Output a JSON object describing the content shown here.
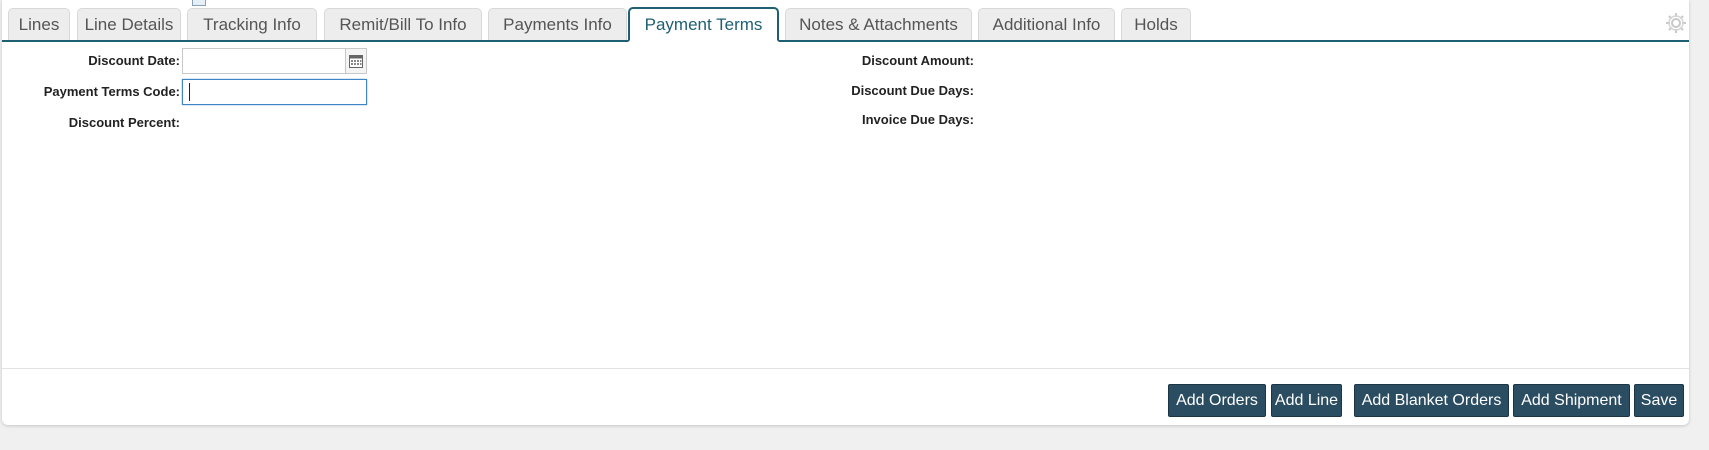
{
  "tabs": [
    {
      "label": "Lines"
    },
    {
      "label": "Line Details"
    },
    {
      "label": "Tracking Info"
    },
    {
      "label": "Remit/Bill To Info"
    },
    {
      "label": "Payments Info"
    },
    {
      "label": "Payment Terms",
      "active": true
    },
    {
      "label": "Notes & Attachments"
    },
    {
      "label": "Additional Info"
    },
    {
      "label": "Holds"
    }
  ],
  "form": {
    "left": {
      "discount_date_label": "Discount Date:",
      "discount_date_value": "",
      "payment_terms_code_label": "Payment Terms Code:",
      "payment_terms_code_value": "",
      "discount_percent_label": "Discount Percent:"
    },
    "right": {
      "discount_amount_label": "Discount Amount:",
      "discount_due_days_label": "Discount Due Days:",
      "invoice_due_days_label": "Invoice Due Days:"
    }
  },
  "footer": {
    "add_orders": "Add Orders",
    "add_line": "Add Line",
    "add_blanket_orders": "Add Blanket Orders",
    "add_shipment": "Add Shipment",
    "save": "Save"
  },
  "colors": {
    "accent": "#1f5f73",
    "button": "#2b4d62",
    "focus": "#3e86c6"
  },
  "icons": [
    "document-icon",
    "gear-icon",
    "calendar-icon"
  ]
}
